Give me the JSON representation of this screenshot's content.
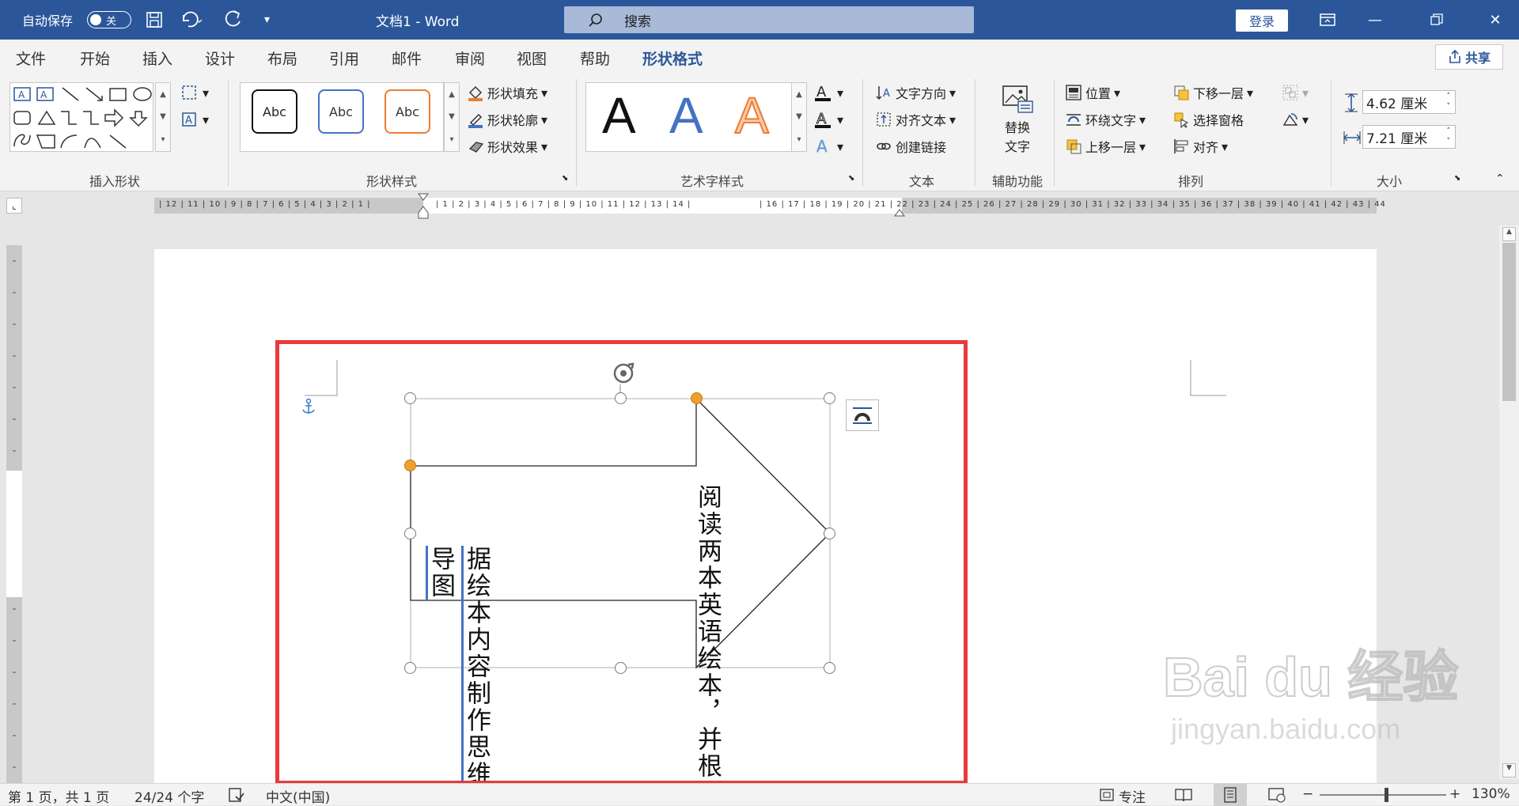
{
  "titlebar": {
    "autosave_label": "自动保存",
    "autosave_state": "关",
    "doc_title": "文档1  -  Word",
    "search_placeholder": "搜索",
    "login_label": "登录"
  },
  "tabs": [
    {
      "label": "文件"
    },
    {
      "label": "开始"
    },
    {
      "label": "插入"
    },
    {
      "label": "设计"
    },
    {
      "label": "布局"
    },
    {
      "label": "引用"
    },
    {
      "label": "邮件"
    },
    {
      "label": "审阅"
    },
    {
      "label": "视图"
    },
    {
      "label": "帮助"
    },
    {
      "label": "形状格式"
    }
  ],
  "share_label": "共享",
  "ribbon": {
    "insert_shapes": {
      "label": "插入形状"
    },
    "shape_styles": {
      "label": "形状样式",
      "sample": "Abc",
      "fill": "形状填充",
      "outline": "形状轮廓",
      "effects": "形状效果"
    },
    "wordart": {
      "label": "艺术字样式",
      "sample": "A"
    },
    "text": {
      "label": "文本",
      "direction": "文字方向",
      "align": "对齐文本",
      "link": "创建链接"
    },
    "accessibility": {
      "label": "辅助功能",
      "alt_text_line1": "替换",
      "alt_text_line2": "文字"
    },
    "arrange": {
      "label": "排列",
      "position": "位置",
      "wrap": "环绕文字",
      "bring_forward": "上移一层",
      "send_backward": "下移一层",
      "selection_pane": "选择窗格",
      "align": "对齐"
    },
    "size": {
      "label": "大小",
      "height": "4.62 厘米",
      "width": "7.21 厘米"
    }
  },
  "ruler": {
    "h_left": "| 12 | 11 | 10 | 9 | 8 | 7 | 6 | 5 | 4 | 3 | 2 | 1 |",
    "h_mid": "| 1 | 2 | 3 | 4 | 5 | 6 | 7 | 8 | 9 | 10 | 11 | 12 | 13 | 14 |",
    "h_right": "| 16 | 17 | 18 | 19 | 20 | 21 | 22 | 23 | 24 | 25 | 26 | 27 | 28 | 29 | 30 | 31 | 32 | 33 | 34 | 35 | 36 | 37 | 38 | 39 | 40 | 41 | 42 | 43 | 44"
  },
  "document": {
    "arrow_text_col1": "阅读两本英语绘本，并根",
    "arrow_text_col2": "据绘本内容制作思维导图"
  },
  "status": {
    "page": "第 1 页，共 1 页",
    "words": "24/24 个字",
    "language": "中文(中国)",
    "focus": "专注",
    "zoom": "130%"
  },
  "watermark": {
    "brand": "Bai du 经验",
    "url": "jingyan.baidu.com"
  },
  "colors": {
    "brand_blue": "#2b579a",
    "highlight_red": "#e83a3a",
    "handle_orange": "#f0a030"
  }
}
